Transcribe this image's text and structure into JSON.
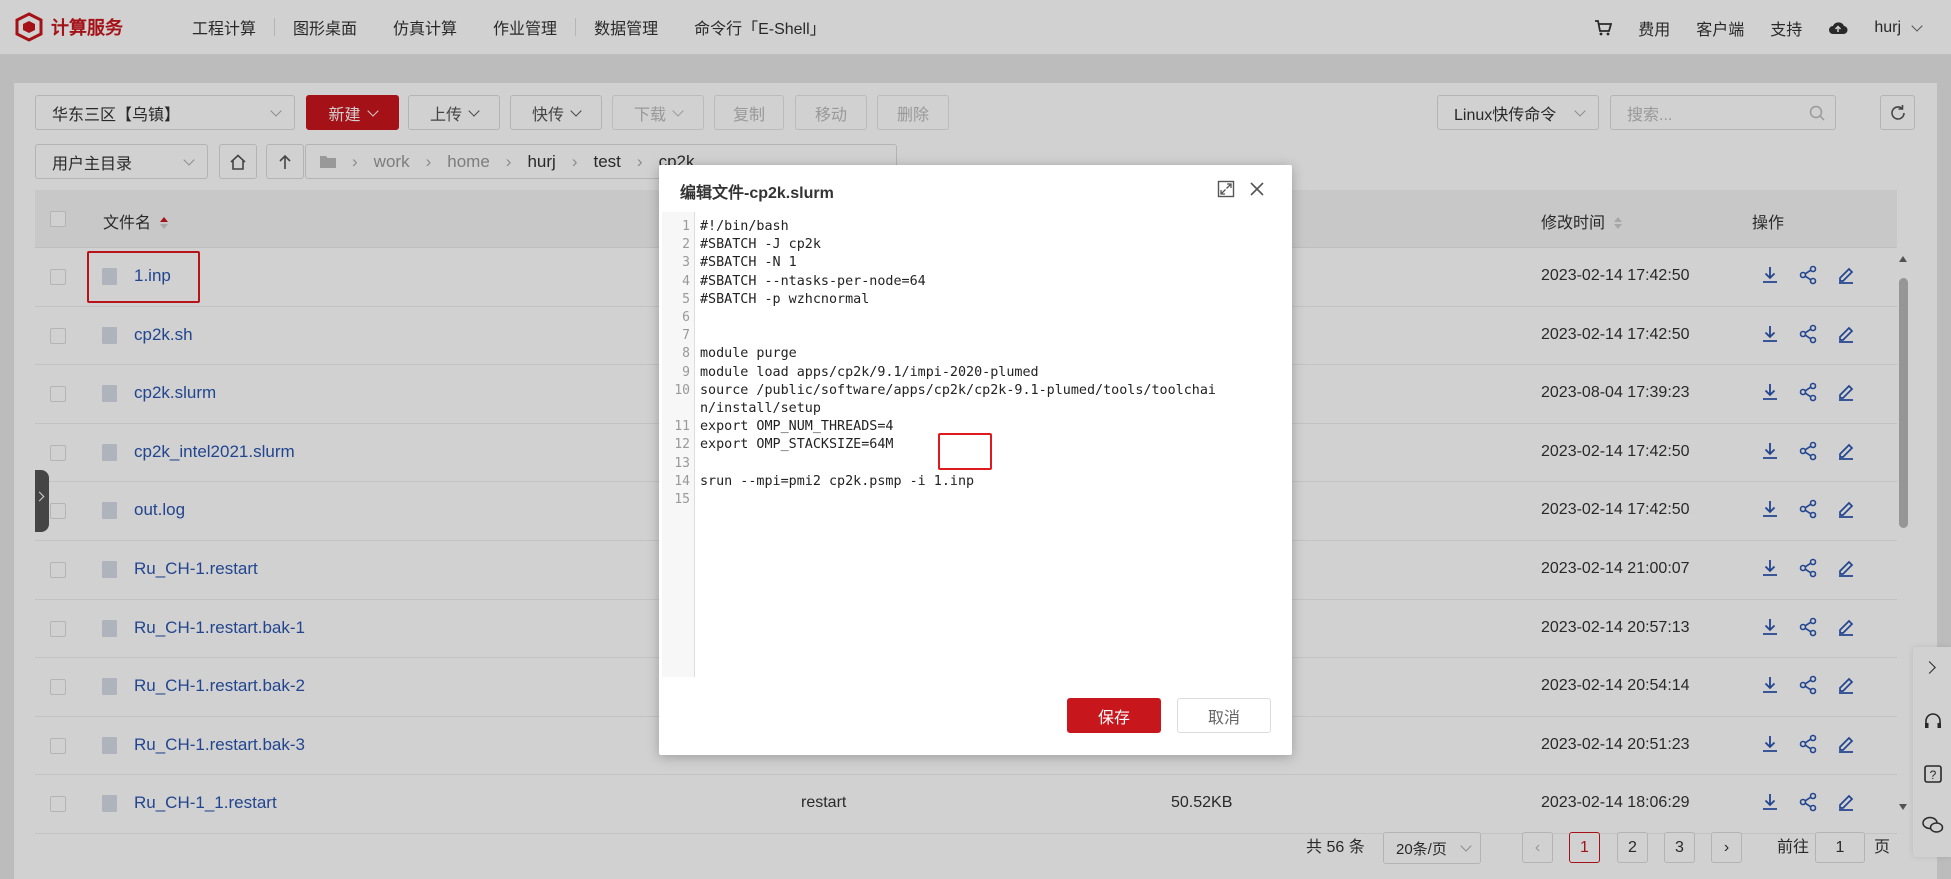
{
  "app": {
    "brand": "计算服务",
    "brand_color": "#c8161d"
  },
  "nav": {
    "items": [
      "工程计算",
      "图形桌面",
      "仿真计算",
      "作业管理",
      "数据管理",
      "命令行「E-Shell」"
    ]
  },
  "top_right": {
    "cost": "费用",
    "client": "客户端",
    "support": "支持",
    "user": "hurj"
  },
  "toolbar": {
    "region": "华东三区【乌镇】",
    "new": "新建",
    "upload": "上传",
    "fast_transfer": "快传",
    "download": "下载",
    "copy": "复制",
    "move": "移动",
    "delete": "删除",
    "linux_cmd": "Linux快传命令",
    "search_placeholder": "搜索..."
  },
  "path_bar": {
    "root_select": "用户主目录",
    "crumbs": [
      "work",
      "home",
      "hurj",
      "test",
      "cp2k"
    ]
  },
  "table": {
    "headers": {
      "name": "文件名",
      "mtime": "修改时间",
      "actions": "操作"
    },
    "rows": [
      {
        "name": "1.inp",
        "type": "",
        "size": "",
        "mtime": "2023-02-14 17:42:50"
      },
      {
        "name": "cp2k.sh",
        "type": "",
        "size": "",
        "mtime": "2023-02-14 17:42:50"
      },
      {
        "name": "cp2k.slurm",
        "type": "",
        "size": "",
        "mtime": "2023-08-04 17:39:23"
      },
      {
        "name": "cp2k_intel2021.slurm",
        "type": "",
        "size": "",
        "mtime": "2023-02-14 17:42:50"
      },
      {
        "name": "out.log",
        "type": "",
        "size": "",
        "mtime": "2023-02-14 17:42:50"
      },
      {
        "name": "Ru_CH-1.restart",
        "type": "",
        "size": "",
        "mtime": "2023-02-14 21:00:07"
      },
      {
        "name": "Ru_CH-1.restart.bak-1",
        "type": "",
        "size": "",
        "mtime": "2023-02-14 20:57:13"
      },
      {
        "name": "Ru_CH-1.restart.bak-2",
        "type": "",
        "size": "",
        "mtime": "2023-02-14 20:54:14"
      },
      {
        "name": "Ru_CH-1.restart.bak-3",
        "type": "",
        "size": "",
        "mtime": "2023-02-14 20:51:23"
      },
      {
        "name": "Ru_CH-1_1.restart",
        "type": "restart",
        "size": "50.52KB",
        "mtime": "2023-02-14 18:06:29"
      }
    ]
  },
  "pagination": {
    "total": "共 56 条",
    "page_size": "20条/页",
    "pages": [
      "1",
      "2",
      "3"
    ],
    "current": "1",
    "goto_label": "前往",
    "goto_value": "1",
    "goto_suffix": "页"
  },
  "modal": {
    "title": "编辑文件-cp2k.slurm",
    "save": "保存",
    "cancel": "取消",
    "lines": [
      {
        "n": "1",
        "text": "#!/bin/bash"
      },
      {
        "n": "2",
        "text": "#SBATCH -J cp2k"
      },
      {
        "n": "3",
        "text": "#SBATCH -N 1"
      },
      {
        "n": "4",
        "text": "#SBATCH --ntasks-per-node=64"
      },
      {
        "n": "5",
        "text": "#SBATCH -p wzhcnormal"
      },
      {
        "n": "6",
        "text": ""
      },
      {
        "n": "7",
        "text": ""
      },
      {
        "n": "8",
        "text": "module purge"
      },
      {
        "n": "9",
        "text": "module load apps/cp2k/9.1/impi-2020-plumed"
      },
      {
        "n": "10",
        "text": "source /public/software/apps/cp2k/cp2k-9.1-plumed/tools/toolchai"
      },
      {
        "n": "",
        "text": "n/install/setup"
      },
      {
        "n": "11",
        "text": "export OMP_NUM_THREADS=4"
      },
      {
        "n": "12",
        "text": "export OMP_STACKSIZE=64M"
      },
      {
        "n": "13",
        "text": ""
      },
      {
        "n": "14",
        "text": "srun --mpi=pmi2 cp2k.psmp -i 1.inp"
      },
      {
        "n": "15",
        "text": ""
      }
    ]
  },
  "colors": {
    "accent": "#c8161d",
    "link": "#2a55b0",
    "highlight_box": "#e0191f"
  }
}
